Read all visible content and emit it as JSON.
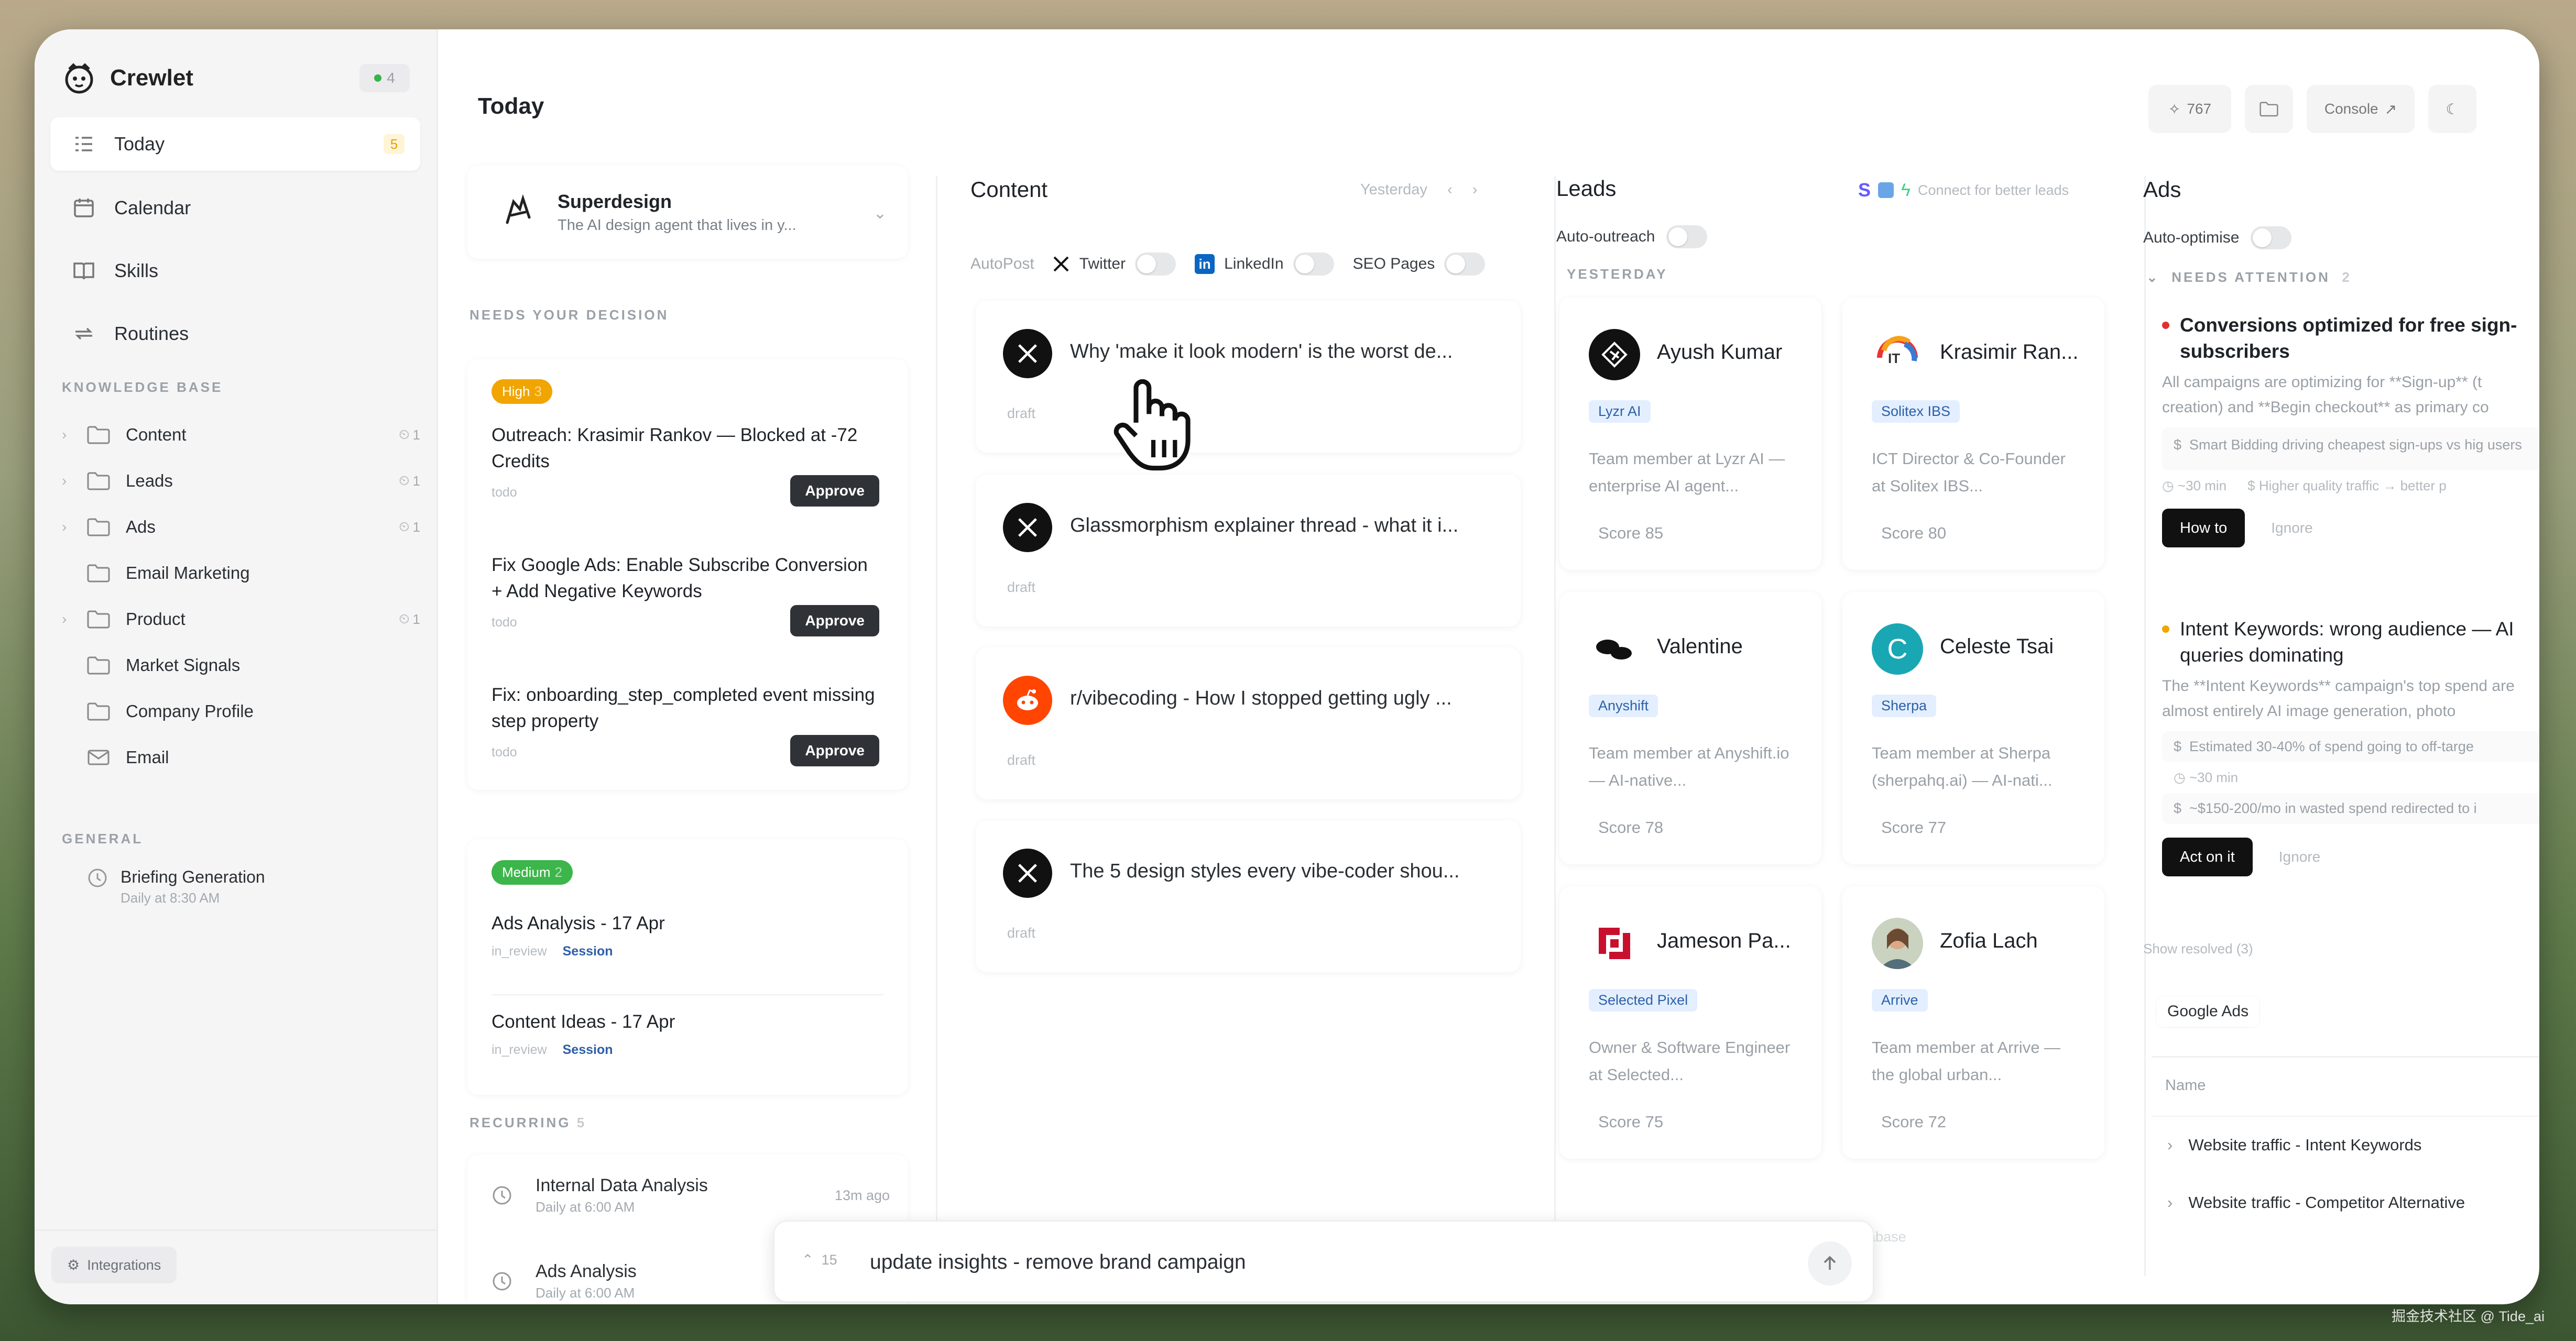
{
  "app": {
    "name": "Crewlet",
    "status_count": "4"
  },
  "sidebar": {
    "nav": [
      {
        "label": "Today",
        "badge": "5",
        "icon": "today-list-icon"
      },
      {
        "label": "Calendar",
        "icon": "calendar-icon"
      },
      {
        "label": "Skills",
        "icon": "book-icon"
      },
      {
        "label": "Routines",
        "icon": "repeat-icon"
      }
    ],
    "knowledge_base_label": "KNOWLEDGE BASE",
    "kb": [
      {
        "label": "Content",
        "count": "1"
      },
      {
        "label": "Leads",
        "count": "1"
      },
      {
        "label": "Ads",
        "count": "1"
      },
      {
        "label": "Email Marketing"
      },
      {
        "label": "Product",
        "count": "1"
      },
      {
        "label": "Market Signals"
      },
      {
        "label": "Company Profile"
      },
      {
        "label": "Email"
      }
    ],
    "general_label": "GENERAL",
    "briefing": {
      "title": "Briefing Generation",
      "schedule": "Daily at 8:30 AM"
    },
    "integrations": "Integrations"
  },
  "header": {
    "title": "Today",
    "stars": "767",
    "console": "Console"
  },
  "agent": {
    "name": "Superdesign",
    "tagline": "The AI design agent that lives in y..."
  },
  "decisions": {
    "label": "NEEDS YOUR DECISION",
    "high": {
      "label": "High",
      "count": "3"
    },
    "tasks": [
      {
        "title": "Outreach: Krasimir Rankov — Blocked at -72 Credits",
        "state": "todo",
        "action": "Approve"
      },
      {
        "title": "Fix Google Ads: Enable Subscribe Conversion + Add Negative Keywords",
        "state": "todo",
        "action": "Approve"
      },
      {
        "title": "Fix: onboarding_step_completed event missing step property",
        "state": "todo",
        "action": "Approve"
      }
    ],
    "medium": {
      "label": "Medium",
      "count": "2"
    },
    "medium_tasks": [
      {
        "title": "Ads Analysis - 17 Apr",
        "state": "in_review",
        "tag": "Session"
      },
      {
        "title": "Content Ideas - 17 Apr",
        "state": "in_review",
        "tag": "Session"
      }
    ],
    "recurring_label": "RECURRING",
    "recurring_count": "5",
    "recurring": [
      {
        "title": "Internal Data Analysis",
        "schedule": "Daily at 6:00 AM",
        "ago": "13m ago"
      },
      {
        "title": "Ads Analysis",
        "schedule": "Daily at 6:00 AM"
      }
    ]
  },
  "content": {
    "title": "Content",
    "date": "Yesterday",
    "autopost": "AutoPost",
    "twitter": "Twitter",
    "linkedin": "LinkedIn",
    "seo": "SEO Pages",
    "posts": [
      {
        "title": "Why 'make it look modern' is the worst de...",
        "state": "draft",
        "icon": "x-logo-icon"
      },
      {
        "title": "Glassmorphism explainer thread - what it i...",
        "state": "draft",
        "icon": "x-logo-icon"
      },
      {
        "title": "r/vibecoding - How I stopped getting ugly ...",
        "state": "draft",
        "icon": "reddit-logo-icon"
      },
      {
        "title": "The 5 design styles every vibe-coder shou...",
        "state": "draft",
        "icon": "x-logo-icon"
      }
    ]
  },
  "leads": {
    "title": "Leads",
    "connect": "Connect for better leads",
    "auto_outreach": "Auto-outreach",
    "group": "YESTERDAY",
    "cards": [
      {
        "name": "Ayush Kumar",
        "company": "Lyzr AI",
        "desc": "Team member at Lyzr AI — enterprise AI agent...",
        "score": "Score 85"
      },
      {
        "name": "Krasimir Ran...",
        "company": "Solitex IBS",
        "desc": "ICT Director & Co-Founder at Solitex IBS...",
        "score": "Score 80"
      },
      {
        "name": "Valentine",
        "company": "Anyshift",
        "desc": "Team member at Anyshift.io — AI-native...",
        "score": "Score 78"
      },
      {
        "name": "Celeste Tsai",
        "company": "Sherpa",
        "desc": "Team member at Sherpa (sherpahq.ai) — AI-nati...",
        "score": "Score 77",
        "initial": "C"
      },
      {
        "name": "Jameson Pa...",
        "company": "Selected Pixel",
        "desc": "Owner & Software Engineer at Selected...",
        "score": "Score 75"
      },
      {
        "name": "Zofia Lach",
        "company": "Arrive",
        "desc": "Team member at Arrive — the global urban...",
        "score": "Score 72"
      }
    ],
    "footer": "Supabase"
  },
  "ads": {
    "title": "Ads",
    "auto_optimise": "Auto-optimise",
    "needs_attention": "NEEDS ATTENTION",
    "attention_count": "2",
    "alerts": [
      {
        "title": "Conversions optimized for free sign-subscribers",
        "text": "All campaigns are optimizing for **Sign-up** (t creation) and **Begin checkout** as primary co",
        "points": [
          "Smart Bidding driving cheapest sign-ups vs hig users",
          "~30 min",
          "Higher quality traffic → better p"
        ],
        "action": "How to",
        "ignore": "Ignore"
      },
      {
        "title": "Intent Keywords: wrong audience — AI queries dominating",
        "text": "The **Intent Keywords** campaign's top spend are almost entirely AI image generation, photo",
        "points": [
          "Estimated 30-40% of spend going to off-targe",
          "~30 min",
          "~$150-200/mo in wasted spend redirected to i"
        ],
        "action": "Act on it",
        "ignore": "Ignore"
      }
    ],
    "show_resolved": "Show resolved (3)",
    "platform": "Google Ads",
    "table_header": "Name",
    "rows": [
      "Website traffic - Intent Keywords",
      "Website traffic - Competitor Alternative"
    ]
  },
  "composer": {
    "history_count": "15",
    "text": "update insights - remove brand campaign"
  },
  "watermark": "掘金技术社区 @ Tide_ai"
}
